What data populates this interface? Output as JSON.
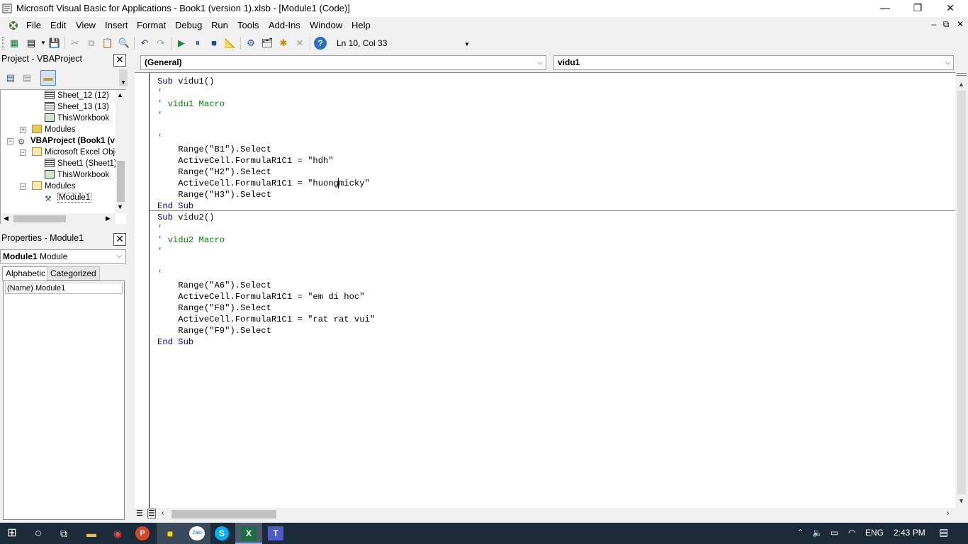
{
  "window": {
    "title": "Microsoft Visual Basic for Applications - Book1 (version 1).xlsb - [Module1 (Code)]",
    "minimize": "—",
    "restore": "❐",
    "close": "✕"
  },
  "menu": {
    "items": [
      "File",
      "Edit",
      "View",
      "Insert",
      "Format",
      "Debug",
      "Run",
      "Tools",
      "Add-Ins",
      "Window",
      "Help"
    ],
    "mdi_min": "–",
    "mdi_restore": "⧉",
    "mdi_close": "✕"
  },
  "toolbar": {
    "position": "Ln 10, Col 33"
  },
  "project": {
    "title": "Project - VBAProject",
    "nodes": [
      "Sheet_12 (12)",
      "Sheet_13 (13)",
      "ThisWorkbook",
      "Modules",
      "VBAProject (Book1 (v",
      "Microsoft Excel Obje",
      "Sheet1 (Sheet1)",
      "ThisWorkbook",
      "Modules",
      "Module1"
    ]
  },
  "properties": {
    "title": "Properties - Module1",
    "object_name": "Module1",
    "object_type": "Module",
    "tab_alphabetic": "Alphabetic",
    "tab_categorized": "Categorized",
    "prop_name": "(Name)",
    "prop_value": "Module1"
  },
  "code": {
    "object_combo": "(General)",
    "proc_combo": "vidu1",
    "lines": [
      {
        "kind": "kw",
        "text": "Sub vidu1()"
      },
      {
        "kind": "cm",
        "text": "'"
      },
      {
        "kind": "cm",
        "text": "' vidu1 Macro"
      },
      {
        "kind": "cm",
        "text": "'"
      },
      {
        "kind": "plain",
        "text": ""
      },
      {
        "kind": "cm",
        "text": "'"
      },
      {
        "kind": "plain",
        "text": "    Range(\"B1\").Select"
      },
      {
        "kind": "plain",
        "text": "    ActiveCell.FormulaR1C1 = \"hdh\""
      },
      {
        "kind": "plain",
        "text": "    Range(\"H2\").Select"
      },
      {
        "kind": "plain",
        "text": "    ActiveCell.FormulaR1C1 = \"huongmicky\""
      },
      {
        "kind": "plain",
        "text": "    Range(\"H3\").Select"
      },
      {
        "kind": "kw",
        "text": "End Sub"
      },
      {
        "kind": "kw",
        "text": "Sub vidu2()"
      },
      {
        "kind": "cm",
        "text": "'"
      },
      {
        "kind": "cm",
        "text": "' vidu2 Macro"
      },
      {
        "kind": "cm",
        "text": "'"
      },
      {
        "kind": "plain",
        "text": ""
      },
      {
        "kind": "cm",
        "text": "'"
      },
      {
        "kind": "plain",
        "text": "    Range(\"A6\").Select"
      },
      {
        "kind": "plain",
        "text": "    ActiveCell.FormulaR1C1 = \"em di hoc\""
      },
      {
        "kind": "plain",
        "text": "    Range(\"F8\").Select"
      },
      {
        "kind": "plain",
        "text": "    ActiveCell.FormulaR1C1 = \"rat rat vui\""
      },
      {
        "kind": "plain",
        "text": "    Range(\"F9\").Select"
      },
      {
        "kind": "kw",
        "text": "End Sub"
      }
    ]
  },
  "taskbar": {
    "language": "ENG",
    "time": "2:43 PM",
    "zalo": "Zalo"
  }
}
